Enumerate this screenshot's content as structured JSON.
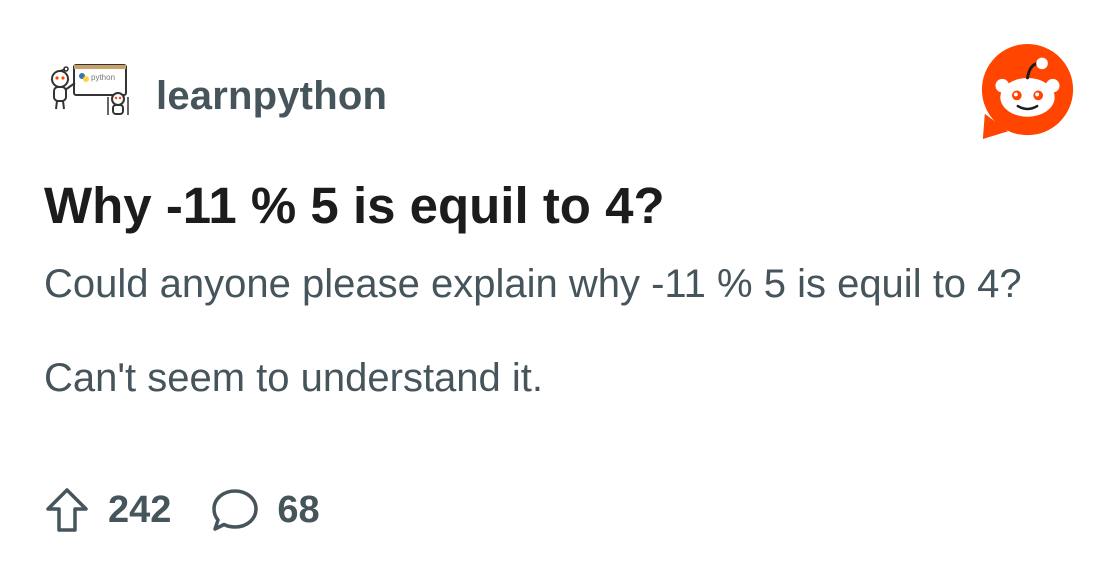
{
  "subreddit": {
    "name": "learnpython",
    "icon": "learnpython-subreddit-icon",
    "icon_text": "python"
  },
  "brand": {
    "icon": "reddit-logo-icon",
    "color": "#ff4500"
  },
  "post": {
    "title": "Why -11 % 5 is equil to 4?",
    "body": [
      "Could anyone please explain why -11 % 5 is equil to 4?",
      "Can't seem to understand it."
    ]
  },
  "stats": {
    "upvotes": "242",
    "upvote_icon": "upvote-arrow-icon",
    "comments": "68",
    "comment_icon": "comment-bubble-icon"
  },
  "colors": {
    "title": "#1c1c1c",
    "secondary_text": "#46545c",
    "background": "#ffffff"
  }
}
